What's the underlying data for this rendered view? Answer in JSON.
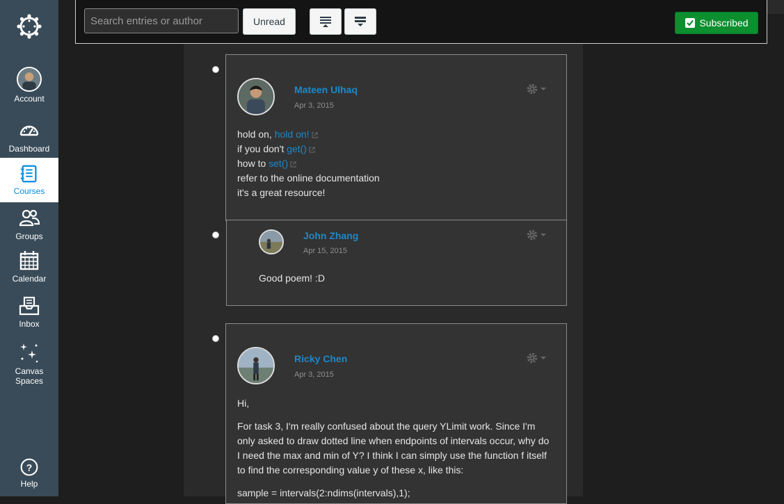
{
  "nav": {
    "account": "Account",
    "dashboard": "Dashboard",
    "courses": "Courses",
    "groups": "Groups",
    "calendar": "Calendar",
    "inbox": "Inbox",
    "canvas_spaces_1": "Canvas",
    "canvas_spaces_2": "Spaces",
    "help": "Help"
  },
  "toolbar": {
    "search_placeholder": "Search entries or author",
    "unread_label": "Unread",
    "subscribed_label": "Subscribed"
  },
  "entries": [
    {
      "author": "Mateen Ulhaq",
      "date": "Apr 3, 2015",
      "lines": {
        "l1_text": "hold on, ",
        "l1_link": "hold on!",
        "l2_text": "if you don't ",
        "l2_link": "get()",
        "l3_text": "how to ",
        "l3_link": "set()",
        "l4": "refer to the online documentation",
        "l5": "it's a great resource!"
      }
    },
    {
      "author": "John Zhang",
      "date": "Apr 15, 2015",
      "message": "Good poem! :D"
    },
    {
      "author": "Ricky Chen",
      "date": "Apr 3, 2015",
      "greeting": "Hi,",
      "para1": "For task 3, I'm really confused about the query YLimit work. Since I'm",
      "para2": "only asked to draw dotted line when endpoints of intervals occur, why do",
      "para3": "I need the max and min of Y? I think I can simply use the function f itself",
      "para4": "to find the corresponding value y of these x, like this:",
      "code": "sample = intervals(2:ndims(intervals),1);"
    }
  ],
  "colors": {
    "nav_bg": "#394b58",
    "link": "#1e88c8",
    "subscribed_bg": "#0b8f2f"
  }
}
